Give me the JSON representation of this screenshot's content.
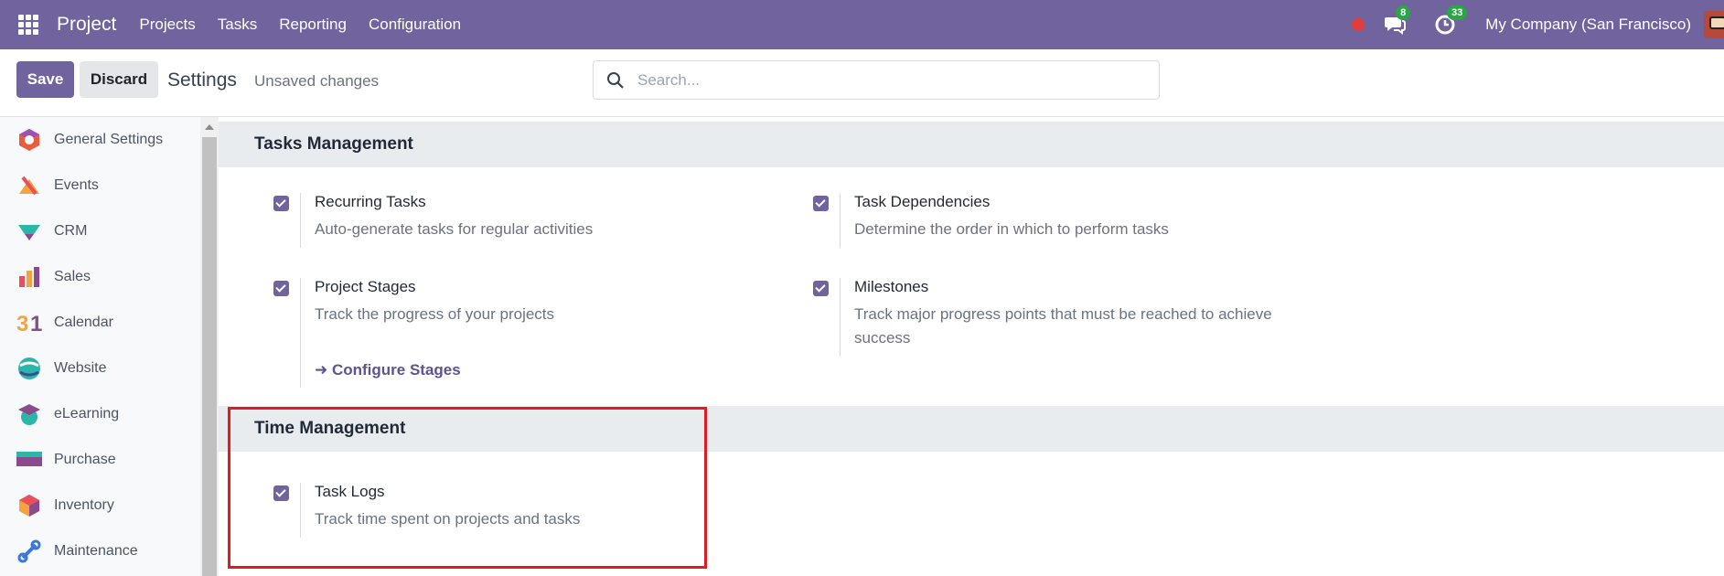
{
  "topbar": {
    "app_name": "Project",
    "menu": [
      "Projects",
      "Tasks",
      "Reporting",
      "Configuration"
    ],
    "messages_count": "8",
    "activities_count": "33",
    "company": "My Company (San Francisco)"
  },
  "control": {
    "save_label": "Save",
    "discard_label": "Discard",
    "title": "Settings",
    "status": "Unsaved changes",
    "search_placeholder": "Search..."
  },
  "sidebar": {
    "items": [
      {
        "label": "General Settings",
        "icon": "general-settings-icon"
      },
      {
        "label": "Events",
        "icon": "events-icon"
      },
      {
        "label": "CRM",
        "icon": "crm-icon"
      },
      {
        "label": "Sales",
        "icon": "sales-icon"
      },
      {
        "label": "Calendar",
        "icon": "calendar-icon"
      },
      {
        "label": "Website",
        "icon": "website-icon"
      },
      {
        "label": "eLearning",
        "icon": "elearning-icon"
      },
      {
        "label": "Purchase",
        "icon": "purchase-icon"
      },
      {
        "label": "Inventory",
        "icon": "inventory-icon"
      },
      {
        "label": "Maintenance",
        "icon": "maintenance-icon"
      }
    ]
  },
  "sections": {
    "tasks_management": {
      "title": "Tasks Management",
      "settings": [
        {
          "title": "Recurring Tasks",
          "desc": "Auto-generate tasks for regular activities",
          "checked": true
        },
        {
          "title": "Task Dependencies",
          "desc": "Determine the order in which to perform tasks",
          "checked": true
        },
        {
          "title": "Project Stages",
          "desc": "Track the progress of your projects",
          "checked": true,
          "link": "Configure Stages"
        },
        {
          "title": "Milestones",
          "desc": "Track major progress points that must be reached to achieve success",
          "checked": true
        }
      ]
    },
    "time_management": {
      "title": "Time Management",
      "settings": [
        {
          "title": "Task Logs",
          "desc": "Track time spent on projects and tasks",
          "checked": true
        }
      ]
    }
  },
  "colors": {
    "brand": "#71639e",
    "highlight": "#e01b24",
    "badge": "#28a745"
  }
}
